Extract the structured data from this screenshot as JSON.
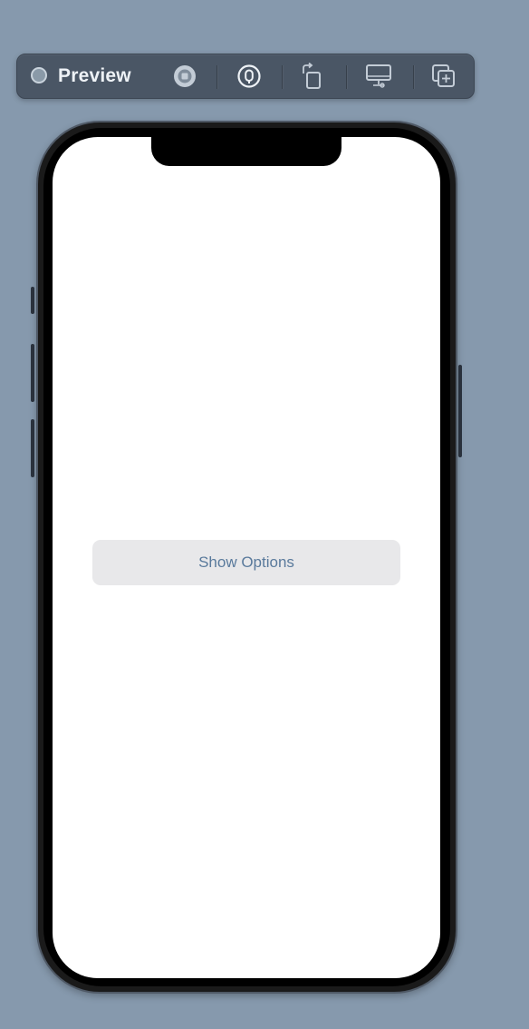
{
  "toolbar": {
    "title": "Preview",
    "buttons": [
      {
        "name": "live-preview-button",
        "icon": "stop-icon"
      },
      {
        "name": "select-mode-button",
        "icon": "cursor-pointer-icon"
      },
      {
        "name": "rotate-device-button",
        "icon": "rotate-device-icon"
      },
      {
        "name": "run-on-device-button",
        "icon": "device-display-icon"
      },
      {
        "name": "duplicate-preview-button",
        "icon": "duplicate-add-icon"
      }
    ]
  },
  "screen": {
    "button_label": "Show Options"
  },
  "colors": {
    "background": "#8699ad",
    "toolbar": "#4a5665",
    "button_bg": "#e8e8ea",
    "button_text": "#5a7a9c",
    "screen": "#ffffff"
  }
}
